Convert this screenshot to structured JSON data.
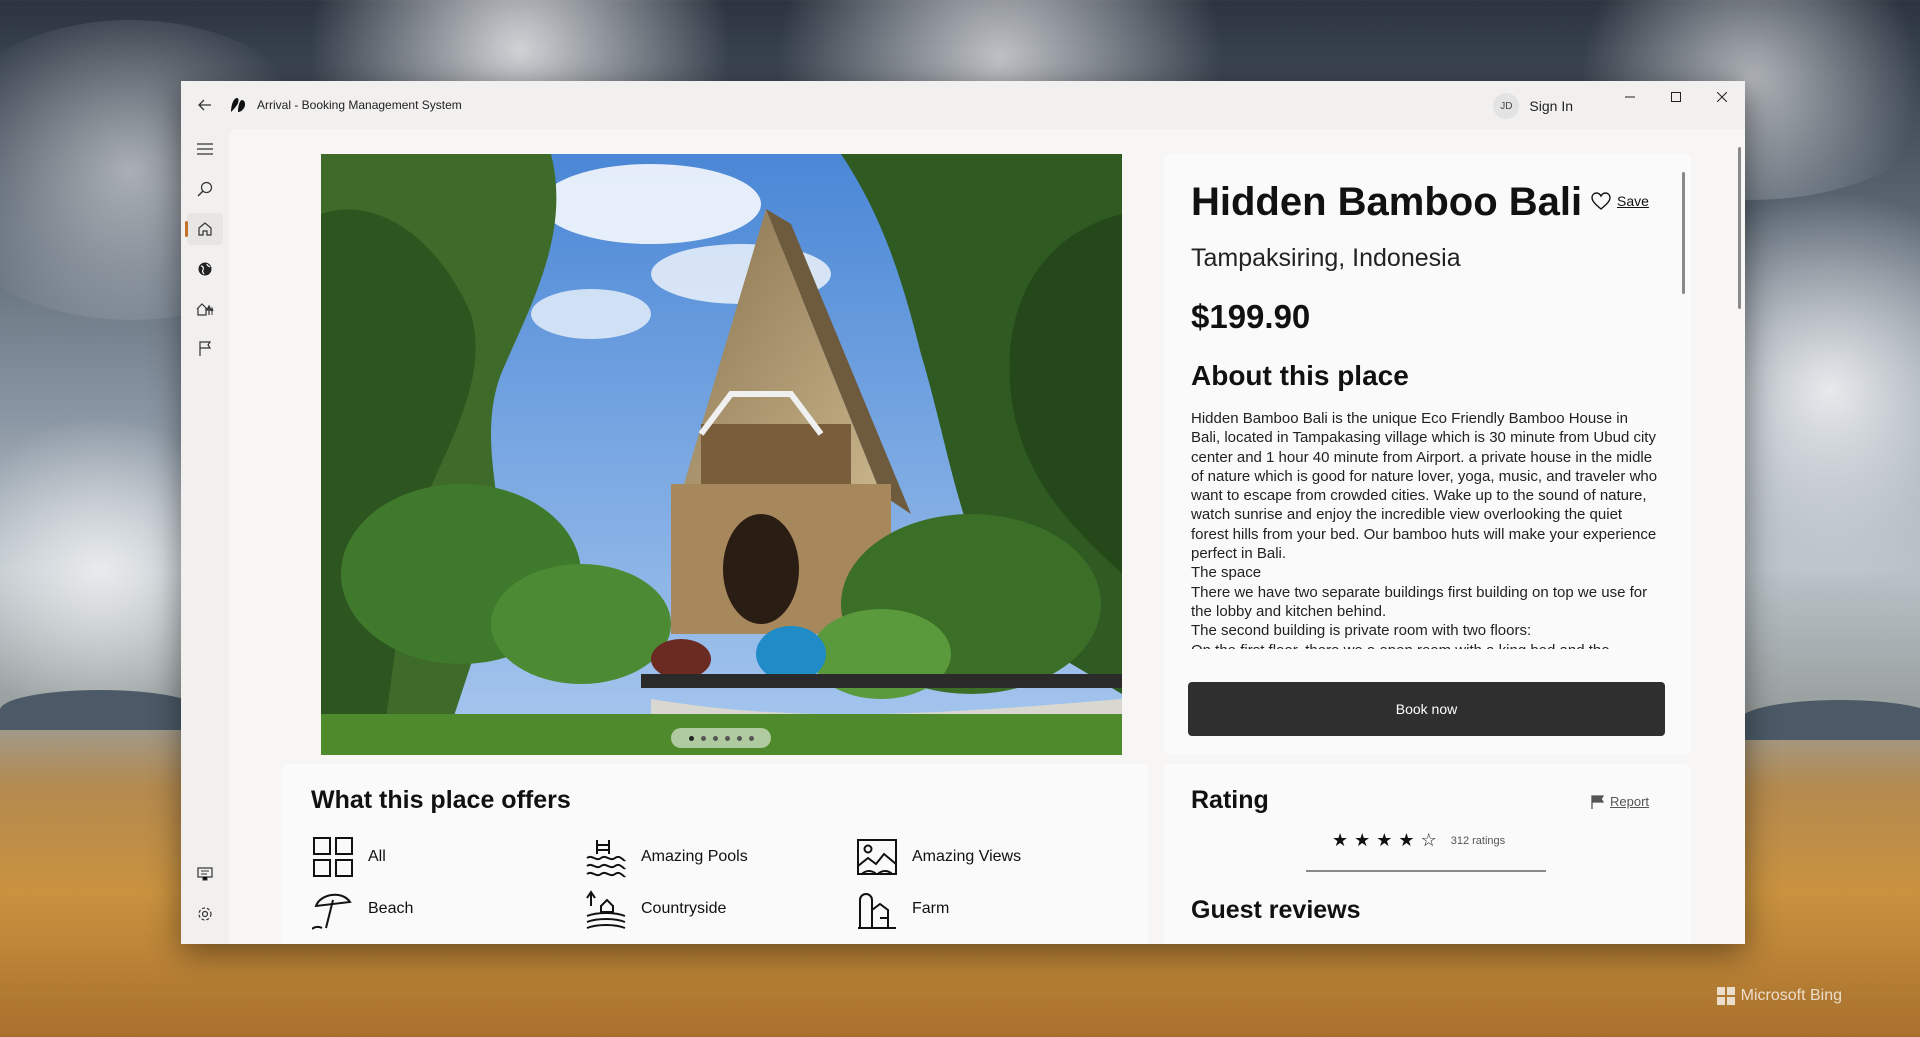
{
  "window": {
    "title": "Arrival - Booking Management System",
    "user_initials": "JD",
    "sign_in_label": "Sign In"
  },
  "nav": {
    "items": [
      {
        "name": "menu",
        "icon": "hamburger-icon"
      },
      {
        "name": "search",
        "icon": "search-icon"
      },
      {
        "name": "home",
        "icon": "home-icon",
        "active": true
      },
      {
        "name": "explore",
        "icon": "globe-icon"
      },
      {
        "name": "stays",
        "icon": "house-trees-icon"
      },
      {
        "name": "reports",
        "icon": "flag-icon"
      }
    ],
    "bottom": [
      {
        "name": "feedback",
        "icon": "feedback-icon"
      },
      {
        "name": "settings",
        "icon": "gear-icon"
      }
    ]
  },
  "hero": {
    "slide_count": 6,
    "active_slide": 0
  },
  "listing": {
    "title": "Hidden Bamboo Bali",
    "save_label": "Save",
    "location": "Tampaksiring, Indonesia",
    "price": "$199.90",
    "about_heading": "About this place",
    "about_paragraphs": [
      "Hidden Bamboo Bali is the unique Eco Friendly Bamboo House in Bali, located in Tampakasing village which is 30 minute from Ubud city center and 1 hour 40 minute from Airport. a private house in the midle of nature which is good for nature lover, yoga, music, and traveler who want to escape from crowded cities. Wake up to the sound of nature, watch sunrise and enjoy the incredible view overlooking the quiet forest hills from your bed. Our bamboo huts will make your experience perfect in Bali.",
      "The space",
      "There we have two separate buildings first building on top we use for the lobby and kitchen behind.",
      "The second building is private room with two floors:",
      "On the first floor, there we a open room with a king bed and the"
    ],
    "book_label": "Book now"
  },
  "offers": {
    "heading": "What this place offers",
    "items": [
      {
        "label": "All",
        "icon": "grid-icon"
      },
      {
        "label": "Amazing Pools",
        "icon": "pool-icon"
      },
      {
        "label": "Amazing Views",
        "icon": "view-icon"
      },
      {
        "label": "Beach",
        "icon": "umbrella-icon"
      },
      {
        "label": "Countryside",
        "icon": "countryside-icon"
      },
      {
        "label": "Farm",
        "icon": "farm-icon"
      }
    ]
  },
  "rating": {
    "heading": "Rating",
    "report_label": "Report",
    "stars": 4,
    "max_stars": 5,
    "ratings_count": "312 ratings",
    "reviews_heading": "Guest reviews"
  }
}
